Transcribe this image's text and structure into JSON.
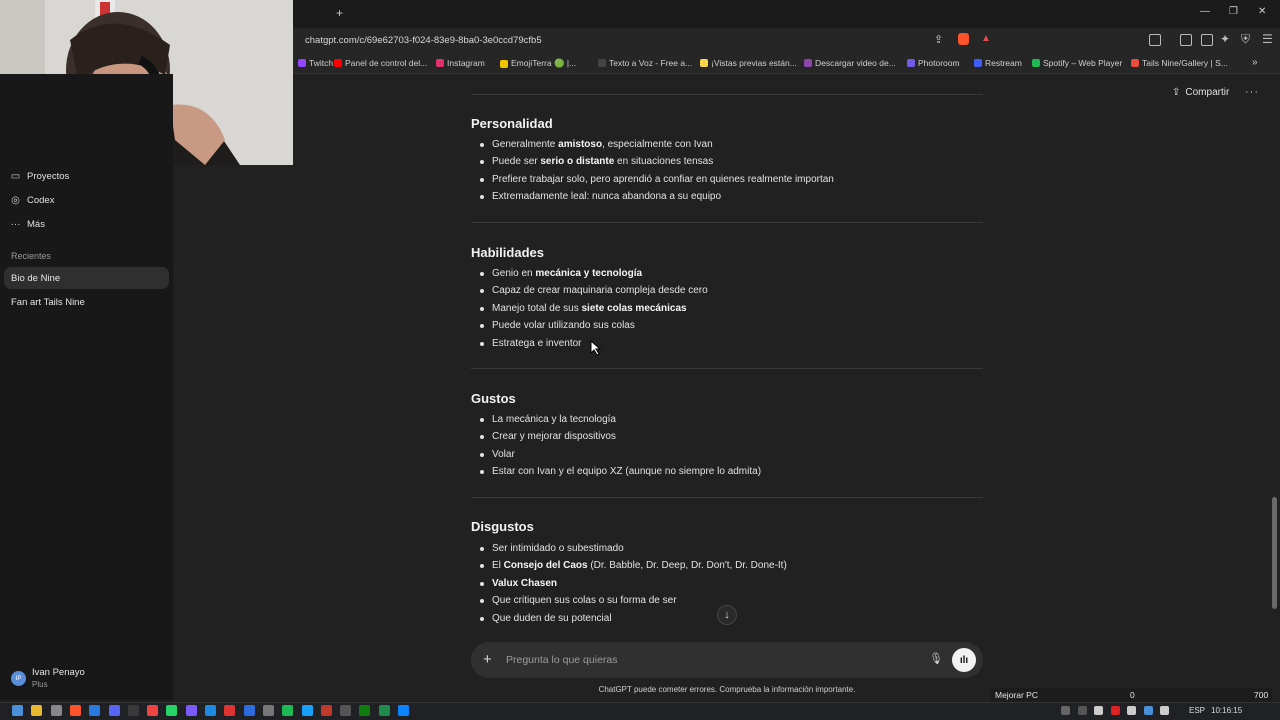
{
  "browser": {
    "new_tab_symbol": "+",
    "url": "chatgpt.com/c/69e62703-f024-83e9-8ba0-3e0ccd79cfb5",
    "bookmarks": [
      {
        "label": "Twitch",
        "color": "#9146ff"
      },
      {
        "label": "Panel de control del...",
        "color": "#ff0000"
      },
      {
        "label": "Instagram",
        "color": "#e1306c"
      },
      {
        "label": "EmojiTerra 🟢 |...",
        "color": "#f5c400"
      },
      {
        "label": "Texto a Voz - Free a...",
        "color": "#444444"
      },
      {
        "label": "¡Vistas previas están...",
        "color": "#f7d44a"
      },
      {
        "label": "Descargar video de...",
        "color": "#8e44ad"
      },
      {
        "label": "Photoroom",
        "color": "#6c5ce7"
      },
      {
        "label": "Restream",
        "color": "#3f5efb"
      },
      {
        "label": "Spotify – Web Player",
        "color": "#1db954"
      },
      {
        "label": "Tails Nine/Gallery | S...",
        "color": "#e74c3c"
      }
    ]
  },
  "sidebar": {
    "items": [
      {
        "label": "Proyectos",
        "icon": "folder-icon",
        "glyph": "▭"
      },
      {
        "label": "Codex",
        "icon": "codex-icon",
        "glyph": "◎"
      },
      {
        "label": "Más",
        "icon": "more-icon",
        "glyph": "···"
      }
    ],
    "recents_label": "Recientes",
    "recents": [
      "Bio de Nine",
      "Fan art Tails Nine"
    ],
    "user": {
      "initials": "IP",
      "name": "Ivan Penayo",
      "plan": "Plus"
    }
  },
  "header": {
    "share_label": "Compartir",
    "share_glyph": "⇪",
    "more_glyph": "···"
  },
  "content": {
    "sections": [
      {
        "title": "Personalidad",
        "items": [
          [
            {
              "t": "Generalmente "
            },
            {
              "t": "amistoso",
              "b": true
            },
            {
              "t": ", especialmente con Ivan"
            }
          ],
          [
            {
              "t": "Puede ser "
            },
            {
              "t": "serio o distante",
              "b": true
            },
            {
              "t": " en situaciones tensas"
            }
          ],
          [
            {
              "t": "Prefiere trabajar solo, pero aprendió a confiar en quienes realmente importan"
            }
          ],
          [
            {
              "t": "Extremadamente leal: nunca abandona a su equipo"
            }
          ]
        ]
      },
      {
        "title": "Habilidades",
        "items": [
          [
            {
              "t": "Genio en "
            },
            {
              "t": "mecánica y tecnología",
              "b": true
            }
          ],
          [
            {
              "t": "Capaz de crear maquinaria compleja desde cero"
            }
          ],
          [
            {
              "t": "Manejo total de sus "
            },
            {
              "t": "siete colas mecánicas",
              "b": true
            }
          ],
          [
            {
              "t": "Puede volar utilizando sus colas"
            }
          ],
          [
            {
              "t": "Estratega e inventor"
            }
          ]
        ]
      },
      {
        "title": "Gustos",
        "items": [
          [
            {
              "t": "La mecánica y la tecnología"
            }
          ],
          [
            {
              "t": "Crear y mejorar dispositivos"
            }
          ],
          [
            {
              "t": "Volar"
            }
          ],
          [
            {
              "t": "Estar con Ivan y el equipo XZ (aunque no siempre lo admita)"
            }
          ]
        ]
      },
      {
        "title": "Disgustos",
        "items": [
          [
            {
              "t": "Ser intimidado o subestimado"
            }
          ],
          [
            {
              "t": "El "
            },
            {
              "t": "Consejo del Caos",
              "b": true
            },
            {
              "t": " (Dr. Babble, Dr. Deep, Dr. Don't, Dr. Done-It)"
            }
          ],
          [
            {
              "t": "Valux Chasen",
              "b": true
            }
          ],
          [
            {
              "t": "Que critiquen sus colas o su forma de ser"
            }
          ],
          [
            {
              "t": "Que duden de su potencial"
            }
          ]
        ]
      }
    ],
    "scroll_down_glyph": "↓"
  },
  "composer": {
    "plus_glyph": "+",
    "placeholder": "Pregunta lo que quieras",
    "mic_glyph": "🎙",
    "voice_glyph": "ılı",
    "disclaimer": "ChatGPT puede cometer errores. Comprueba la información importante."
  },
  "overlay": {
    "label": "Mejorar PC",
    "value_a": "0",
    "value_b": "700"
  },
  "taskbar": {
    "lang": "ESP",
    "time": "10:16:15"
  }
}
